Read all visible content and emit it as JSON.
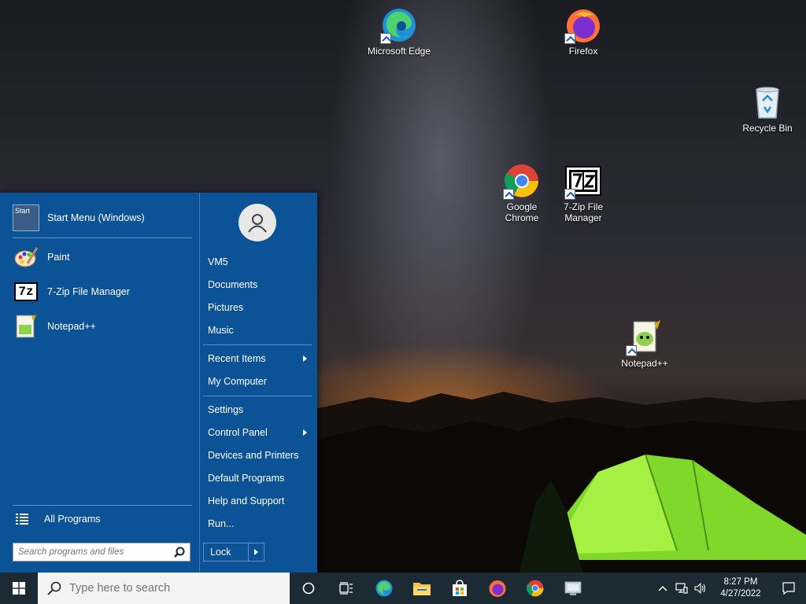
{
  "desktop": {
    "icons": [
      {
        "label": "Microsoft Edge"
      },
      {
        "label": "Firefox"
      },
      {
        "label": "Recycle Bin"
      },
      {
        "label": "Google Chrome"
      },
      {
        "label": "7-Zip File Manager"
      },
      {
        "label": "Notepad++"
      }
    ]
  },
  "start_menu": {
    "pinned": [
      {
        "label": "Start Menu (Windows)",
        "icon": "start-menu-icon"
      },
      {
        "label": "Paint",
        "icon": "paint-icon"
      },
      {
        "label": "7-Zip File Manager",
        "icon": "7zip-icon"
      },
      {
        "label": "Notepad++",
        "icon": "notepadpp-icon"
      }
    ],
    "start_icon_text": "Start",
    "sevenzip_text": "7z",
    "all_programs": "All Programs",
    "search_placeholder": "Search programs and files",
    "right": {
      "user": "VM5",
      "documents": "Documents",
      "pictures": "Pictures",
      "music": "Music",
      "recent_items": "Recent Items",
      "my_computer": "My Computer",
      "settings": "Settings",
      "control_panel": "Control Panel",
      "devices_printers": "Devices and Printers",
      "default_programs": "Default Programs",
      "help_support": "Help and Support",
      "run": "Run..."
    },
    "lock_label": "Lock"
  },
  "taskbar": {
    "search_placeholder": "Type here to search",
    "time": "8:27 PM",
    "date": "4/27/2022"
  },
  "colors": {
    "start_menu_bg": "#0c5296",
    "taskbar_bg": "#1b2a33",
    "accent": "#1a5fb4"
  }
}
